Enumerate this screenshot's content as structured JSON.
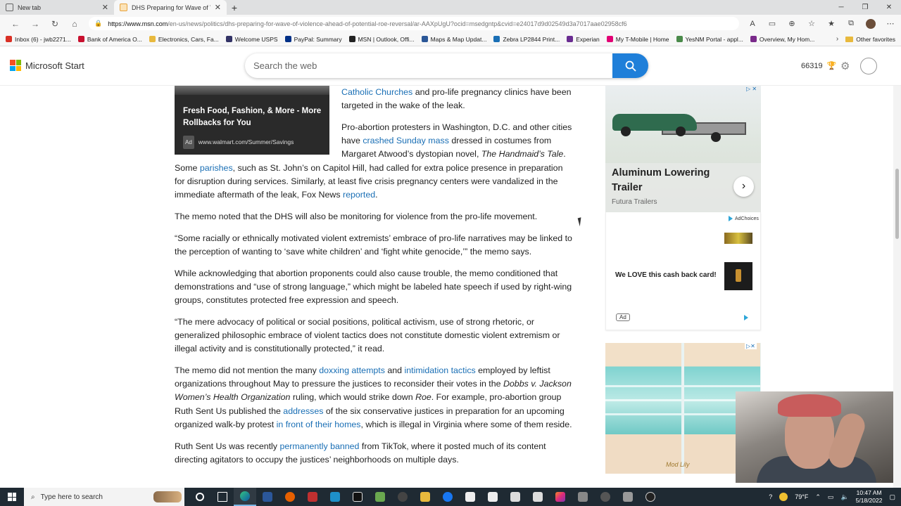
{
  "browser": {
    "tabs": [
      {
        "title": "New tab",
        "active": false
      },
      {
        "title": "DHS Preparing for Wave of Viole",
        "active": true
      }
    ],
    "new_tab": "+",
    "url_host": "https://www.msn.com",
    "url_path": "/en-us/news/politics/dhs-preparing-for-wave-of-violence-ahead-of-potential-roe-reversal/ar-AAXpUgU?ocid=msedgntp&cvid=e24017d9d02549d3a7017aae02958cf6",
    "favorites": [
      {
        "label": "Inbox (6) - jwb2271...",
        "color": "#d93025"
      },
      {
        "label": "Bank of America O...",
        "color": "#c8102e"
      },
      {
        "label": "Electronics, Cars, Fa...",
        "color": "#e8b93d"
      },
      {
        "label": "Welcome USPS",
        "color": "#333366"
      },
      {
        "label": "PayPal: Summary",
        "color": "#003087"
      },
      {
        "label": "MSN | Outlook, Offi...",
        "color": "#222222"
      },
      {
        "label": "Maps & Map Updat...",
        "color": "#2b5797"
      },
      {
        "label": "Zebra LP2844 Print...",
        "color": "#1a6fb5"
      },
      {
        "label": "Experian",
        "color": "#6a2c91"
      },
      {
        "label": "My T-Mobile | Home",
        "color": "#e20074"
      },
      {
        "label": "YesNM Portal - appl...",
        "color": "#4a8a4a"
      },
      {
        "label": "Overview, My Hom...",
        "color": "#7a2a8a"
      }
    ],
    "other_favorites": "Other favorites"
  },
  "header": {
    "brand": "Microsoft Start",
    "search_placeholder": "Search the web",
    "rewards_points": "66319"
  },
  "ad_card": {
    "title": "Fresh Food, Fashion, & More - More Rollbacks for You",
    "tag": "Ad",
    "url": "www.walmart.com/Summer/Savings"
  },
  "article": {
    "p1": {
      "link": "Catholic Churches",
      "text": " and pro-life pregnancy clinics have been targeted in the wake of the leak."
    },
    "p2": {
      "t1": "Pro-abortion protesters in Washington, D.C. and other cities have ",
      "link1": "crashed Sunday mass",
      "t2": " dressed in costumes from Margaret Atwood’s dystopian novel, ",
      "em1": "The Handmaid’s Tale",
      "t3": ". Some ",
      "link2": "parishes",
      "t4": ", such as St. John’s on Capitol Hill, had called for extra police presence in preparation for disruption during services. Similarly, at least five crisis pregnancy centers were vandalized in the immediate aftermath of the leak, Fox News ",
      "link3": "reported",
      "t5": "."
    },
    "p3": "The memo noted that the DHS will also be monitoring for violence from the pro-life movement.",
    "p4": "“Some racially or ethnically motivated violent extremists’ embrace of pro-life narratives may be linked to the perception of wanting to ‘save white children’ and ‘fight white genocide,’” the memo says.",
    "p5": "While acknowledging that abortion proponents could also cause trouble, the memo conditioned that demonstrations and “use of strong language,” which might be labeled hate speech if used by right-wing groups, constitutes protected free expression and speech.",
    "p6": "“The mere advocacy of political or social positions, political activism, use of strong rhetoric, or generalized philosophic embrace of violent tactics does not constitute domestic violent extremism or illegal activity and is constitutionally protected,” it read.",
    "p7": {
      "t1": "The memo did not mention the many ",
      "link1": "doxxing attempts",
      "t2": " and ",
      "link2": "intimidation tactics",
      "t3": " employed by leftist organizations throughout May to pressure the justices to reconsider their votes in the ",
      "em1": "Dobbs v. Jackson Women’s Health Organization",
      "t4": " ruling, which would strike down ",
      "em2": "Roe",
      "t5": ". For example, pro-abortion group Ruth Sent Us published the ",
      "link3": "addresses",
      "t6": " of the six conservative justices in preparation for an upcoming organized walk-by protest ",
      "link4": "in front of their homes",
      "t7": ", which is illegal in Virginia where some of them reside."
    },
    "p8": {
      "t1": "Ruth Sent Us was recently ",
      "link1": "permanently banned",
      "t2": " from TikTok, where it posted much of its content directing agitators to occupy the justices’ neighborhoods on multiple days."
    }
  },
  "rail": {
    "ad1_title": "Aluminum Lowering Trailer",
    "ad1_sponsor": "Futura Trailers",
    "adchoices": "AdChoices",
    "ad2_text": "We LOVE this cash back card!",
    "ad2_tag": "Ad",
    "ad3_brand": "Mod Lily"
  },
  "taskbar": {
    "search_placeholder": "Type here to search",
    "temperature": "79°F",
    "time": "10:47 AM",
    "date": "5/18/2022"
  }
}
